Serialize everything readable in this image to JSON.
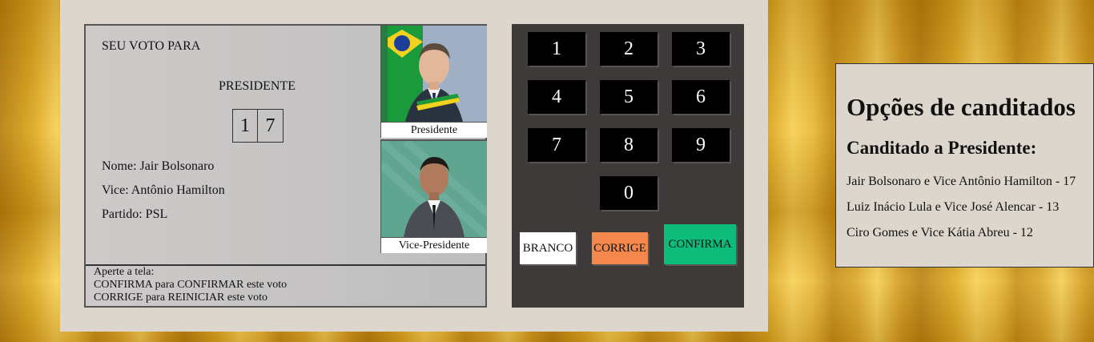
{
  "screen": {
    "heading": "SEU VOTO PARA",
    "office": "PRESIDENTE",
    "digits": [
      "1",
      "7"
    ],
    "name_line": "Nome: Jair Bolsonaro",
    "vice_line": "Vice: Antônio Hamilton",
    "party_line": "Partido: PSL",
    "photo_president_caption": "Presidente",
    "photo_vice_caption": "Vice-Presidente",
    "footer": {
      "line1": "Aperte a tela:",
      "line2": "CONFIRMA para CONFIRMAR este voto",
      "line3": "CORRIGE para REINICIAR este voto"
    }
  },
  "keypad": {
    "keys": [
      "1",
      "2",
      "3",
      "4",
      "5",
      "6",
      "7",
      "8",
      "9",
      "0"
    ],
    "branco": "BRANCO",
    "corrige": "CORRIGE",
    "confirma": "CONFIRMA",
    "colors": {
      "branco": "#ffffff",
      "corrige": "#f4874b",
      "confirma": "#0dbc7a",
      "key": "#000000",
      "panel": "#3e3a3a"
    }
  },
  "options": {
    "title": "Opções de canditados",
    "subtitle": "Canditado a Presidente:",
    "candidates": [
      "Jair Bolsonaro e Vice Antônio Hamilton - 17",
      "Luiz Inácio Lula e Vice José Alencar - 13",
      "Ciro Gomes e Vice Kátia Abreu - 12"
    ]
  }
}
